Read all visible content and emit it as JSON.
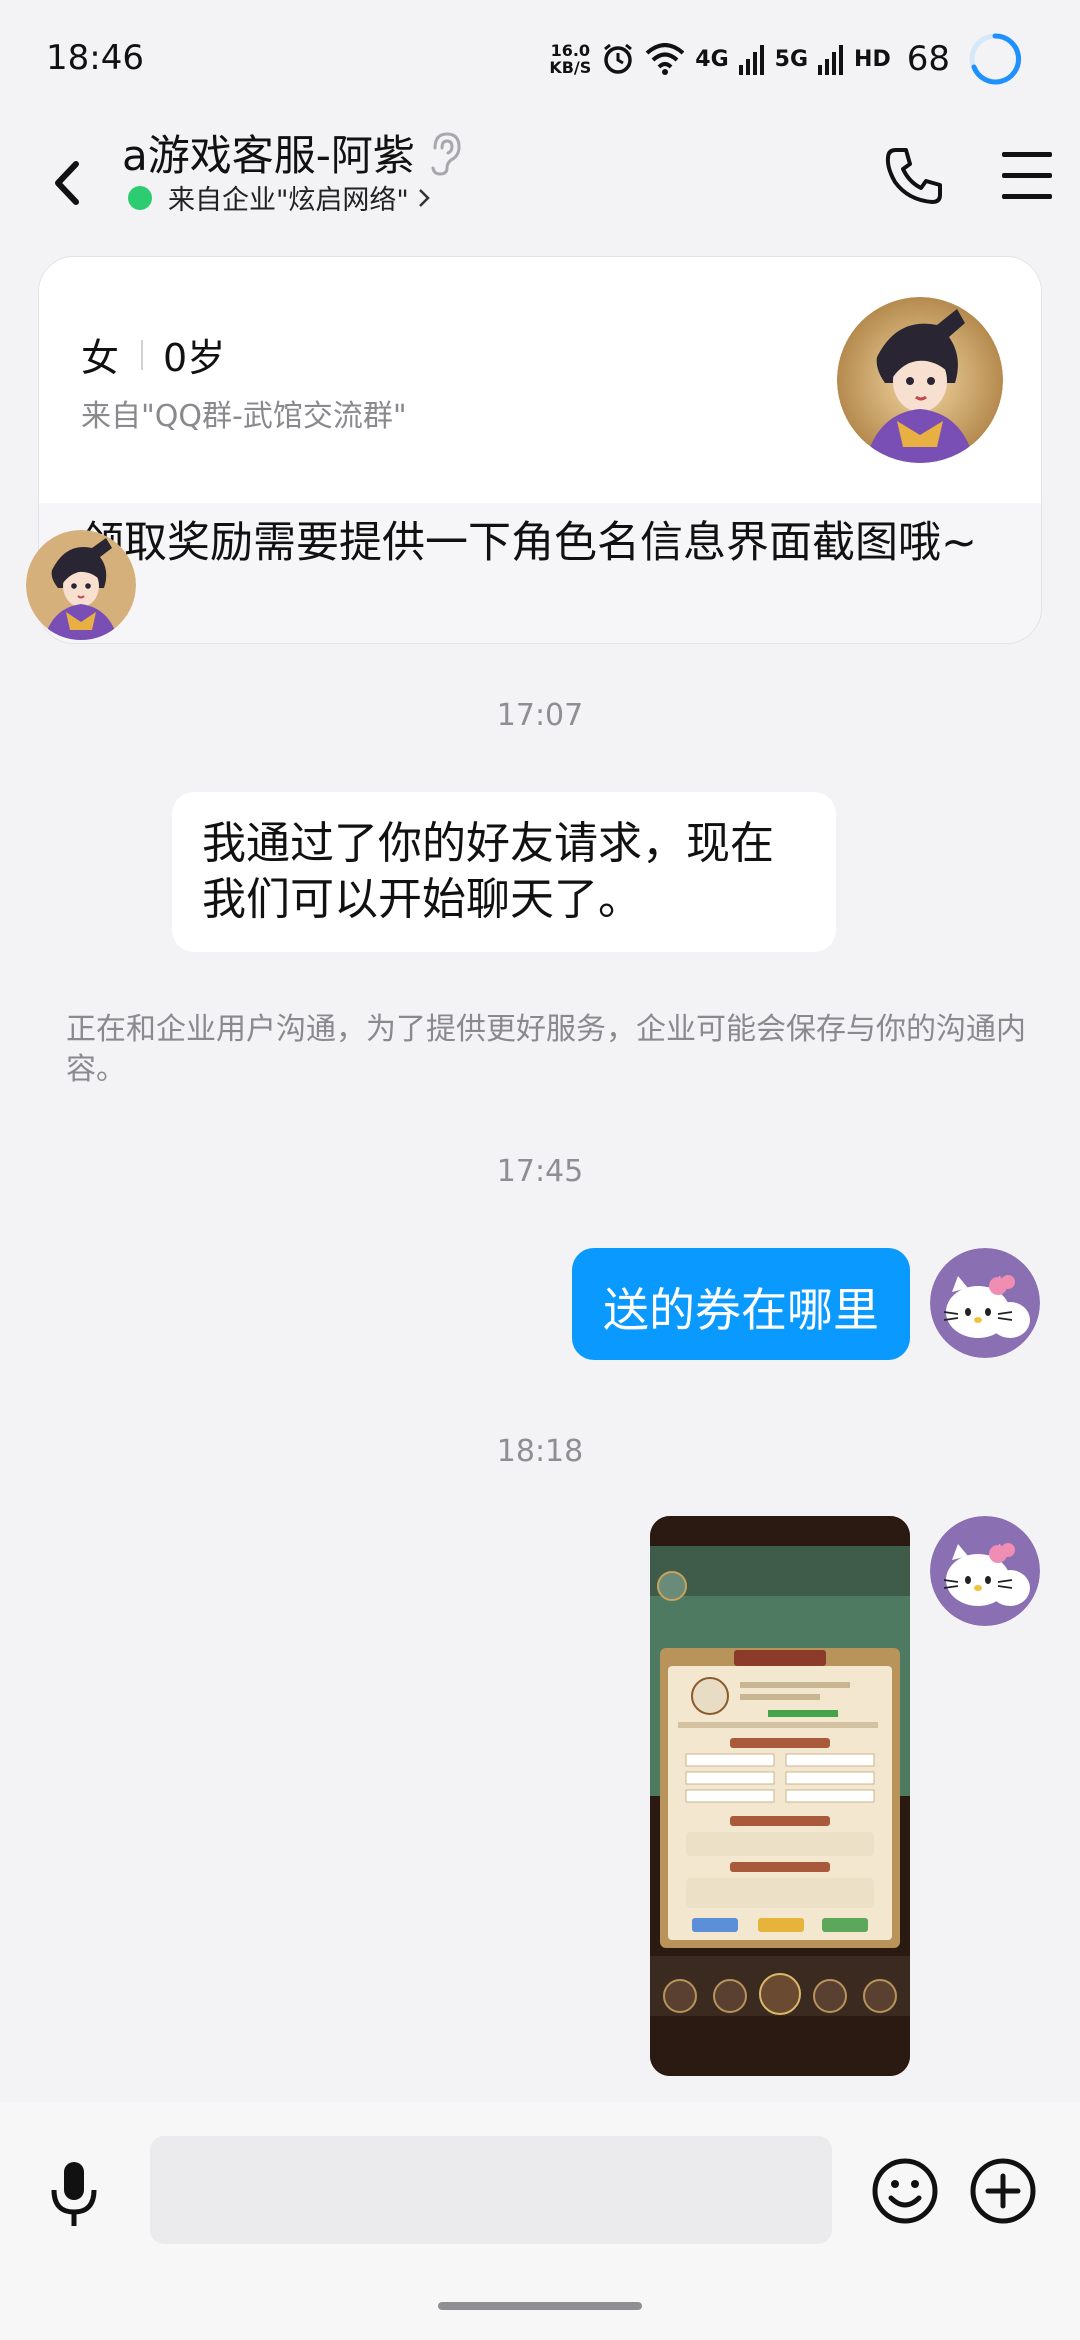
{
  "status_bar": {
    "time": "18:46",
    "net_speed_value": "16.0",
    "net_speed_unit": "KB/S",
    "signal_4g_label": "4G",
    "signal_5g_label": "5G",
    "hd_label": "HD",
    "battery": "68",
    "icons": [
      "alarm-icon",
      "wifi-icon",
      "cell-signal-icon",
      "cell-signal-icon",
      "hd-icon"
    ]
  },
  "header": {
    "title": "a游戏客服-阿紫",
    "subtitle": "来自企业\"炫启网络\"",
    "icons": [
      "back-arrow-icon",
      "ear-icon",
      "phone-icon",
      "menu-icon"
    ]
  },
  "profile_card": {
    "gender": "女",
    "age": "0岁",
    "source": "来自\"QQ群-武馆交流群\"",
    "message": " 领取奖励需要提供一下角色名信息界面截图哦~"
  },
  "chat": {
    "messages": [
      {
        "type": "timestamp",
        "text": "17:07"
      },
      {
        "type": "incoming",
        "text": "我通过了你的好友请求，现在我们可以开始聊天了。"
      },
      {
        "type": "notice",
        "text": "正在和企业用户沟通，为了提供更好服务，企业可能会保存与你的沟通内容。"
      },
      {
        "type": "timestamp",
        "text": "17:45"
      },
      {
        "type": "outgoing",
        "text": "送的券在哪里"
      },
      {
        "type": "timestamp",
        "text": "18:18"
      },
      {
        "type": "outgoing-image",
        "text": ""
      }
    ]
  },
  "input_bar": {
    "placeholder": "",
    "icons": [
      "microphone-icon",
      "emoji-icon",
      "plus-icon"
    ]
  },
  "colors": {
    "accent": "#0a99ff",
    "background": "#f3f3f5",
    "online": "#2ecc71"
  }
}
